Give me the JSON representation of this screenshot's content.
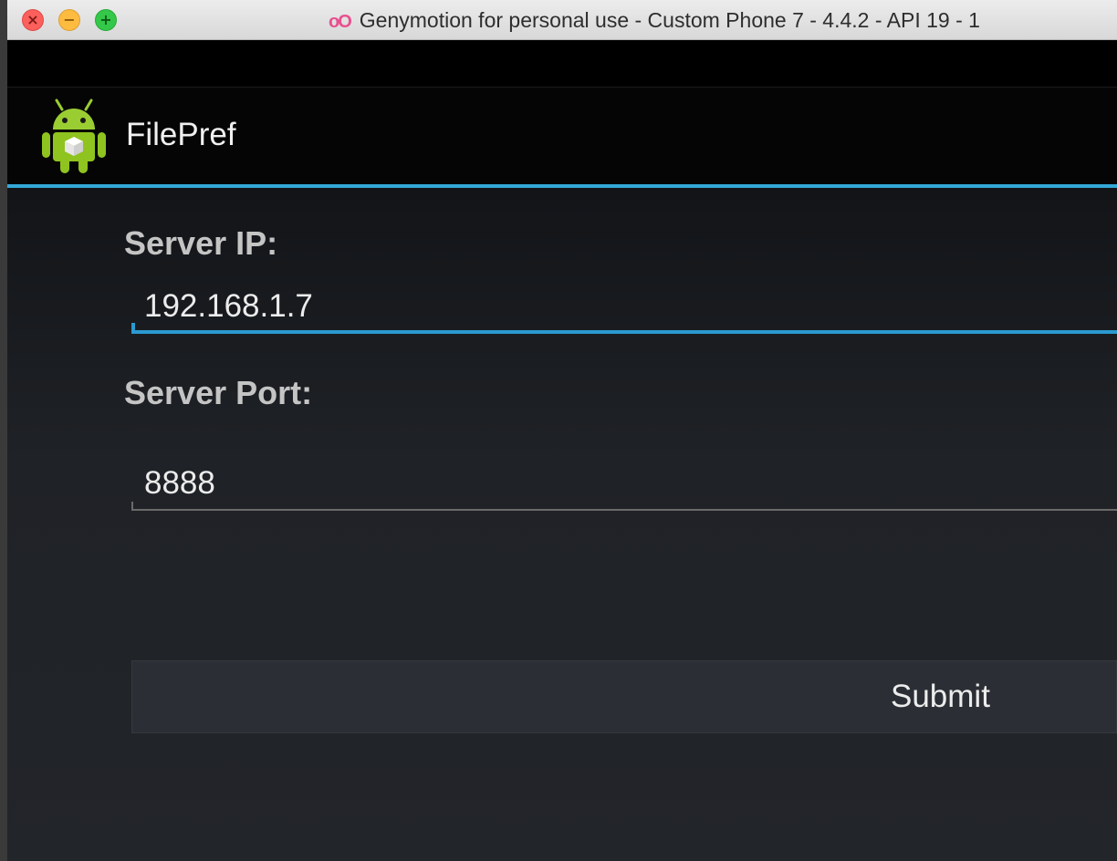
{
  "window": {
    "title": "Genymotion for personal use - Custom Phone 7 - 4.4.2 - API 19 - 1",
    "title_logo": "oO",
    "buttons": [
      "close",
      "minimize",
      "maximize"
    ]
  },
  "app": {
    "title": "FilePref",
    "icon": "android-robot-icon"
  },
  "form": {
    "server_ip_label": "Server IP:",
    "server_ip_value": "192.168.1.7",
    "server_port_label": "Server Port:",
    "server_port_value": "8888",
    "submit_label": "Submit"
  },
  "colors": {
    "accent": "#33a8d8",
    "background": "#1f2226",
    "actionbar": "#050505",
    "close": "#fc605c",
    "minimize": "#fdbc40",
    "maximize": "#34c84a"
  }
}
